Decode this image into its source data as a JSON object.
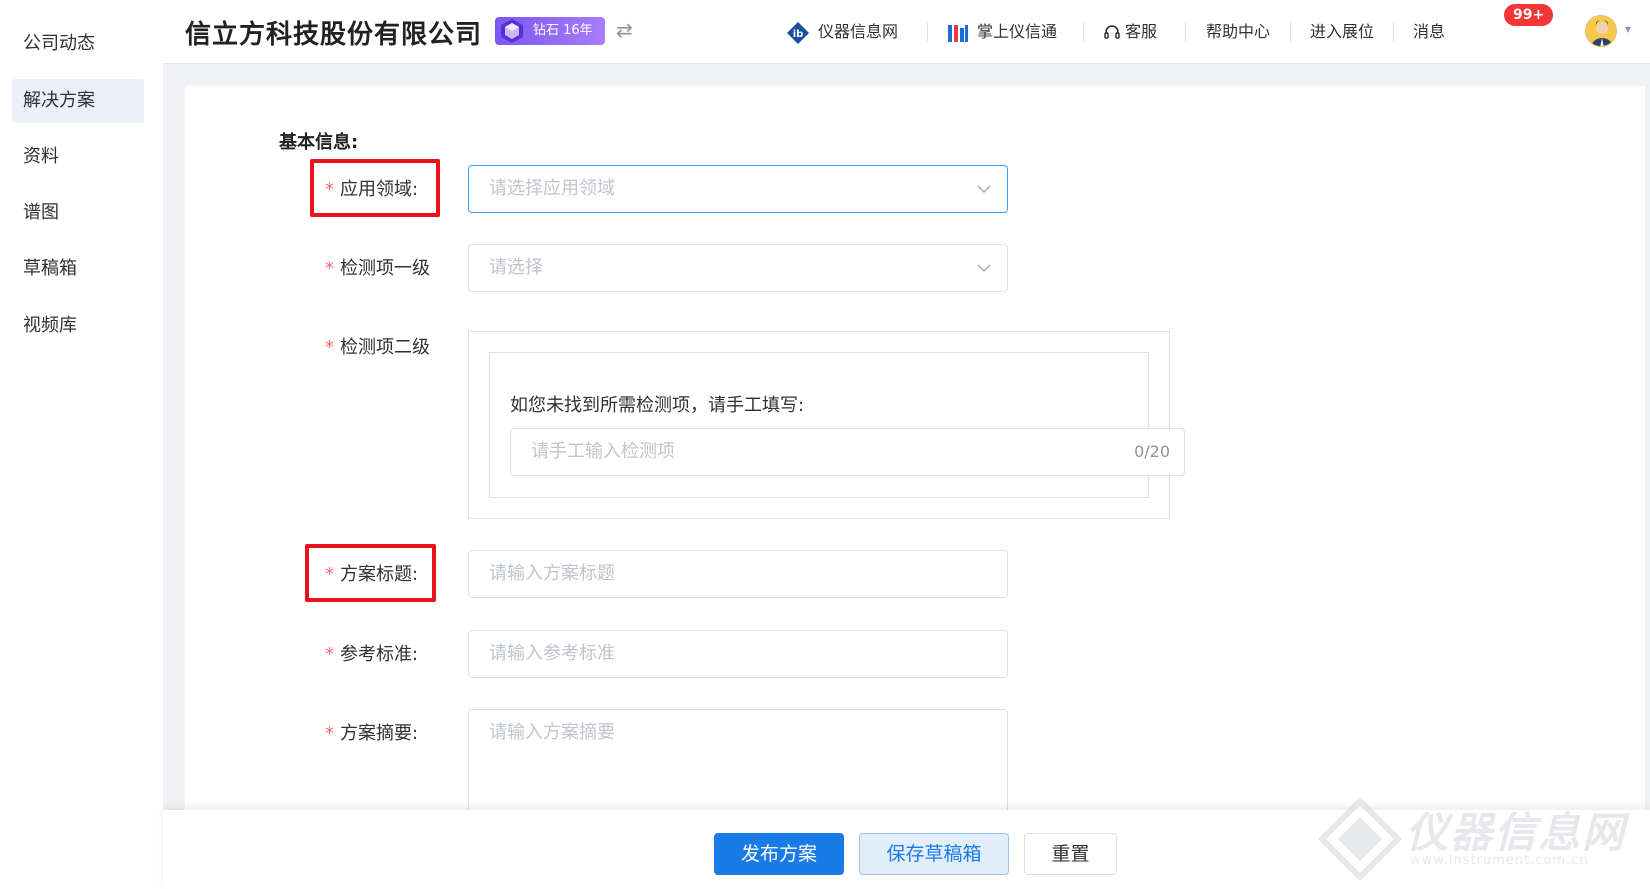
{
  "sidebar": {
    "items": [
      {
        "label": "公司动态",
        "active": false
      },
      {
        "label": "解决方案",
        "active": true
      },
      {
        "label": "资料",
        "active": false
      },
      {
        "label": "谱图",
        "active": false
      },
      {
        "label": "草稿箱",
        "active": false
      },
      {
        "label": "视频库",
        "active": false
      }
    ]
  },
  "header": {
    "company": "信立方科技股份有限公司",
    "badge": "钻石 16年",
    "nav": {
      "instrument_net": "仪器信息网",
      "mobile": "掌上仪信通",
      "service": "客服",
      "help": "帮助中心",
      "booth": "进入展位",
      "messages": "消息"
    },
    "message_count": "99+"
  },
  "form": {
    "section_title": "基本信息:",
    "field_domain": {
      "label": "应用领域:",
      "placeholder": "请选择应用领域"
    },
    "field_level1": {
      "label": "检测项一级",
      "placeholder": "请选择"
    },
    "field_level2": {
      "label": "检测项二级",
      "hint": "如您未找到所需检测项，请手工填写:",
      "placeholder": "请手工输入检测项",
      "counter": "0/20"
    },
    "field_title": {
      "label": "方案标题:",
      "placeholder": "请输入方案标题"
    },
    "field_standard": {
      "label": "参考标准:",
      "placeholder": "请输入参考标准"
    },
    "field_summary": {
      "label": "方案摘要:",
      "placeholder": "请输入方案摘要"
    }
  },
  "actions": {
    "publish": "发布方案",
    "save_draft": "保存草稿箱",
    "reset": "重置"
  },
  "watermark": {
    "text": "仪器信息网",
    "sub": "www.instrument.com.cn"
  },
  "colors": {
    "primary": "#1b7be6",
    "highlight": "#e8121a",
    "required": "#f56c6c",
    "badge": "#7b57f5",
    "notification": "#f23535"
  }
}
